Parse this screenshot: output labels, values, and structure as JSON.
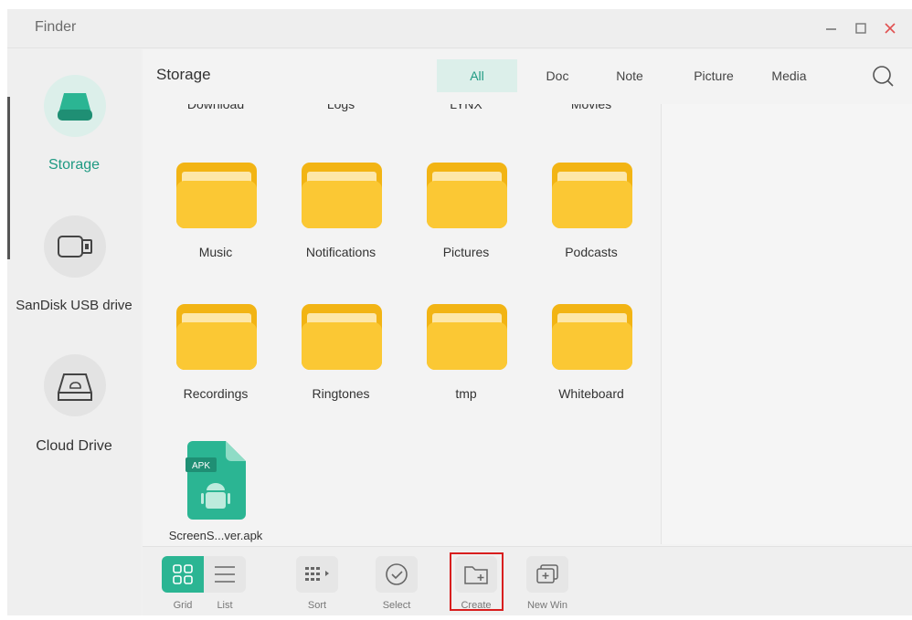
{
  "window": {
    "title": "Finder",
    "controls": {
      "minimize": "minimize",
      "maximize": "maximize",
      "close": "close"
    }
  },
  "sidebar": {
    "items": [
      {
        "label": "Storage",
        "icon": "drive-icon",
        "active": true
      },
      {
        "label": "SanDisk USB drive",
        "icon": "usb-icon",
        "active": false
      },
      {
        "label": "Cloud Drive",
        "icon": "cloud-drive-icon",
        "active": false
      }
    ]
  },
  "header": {
    "title": "Storage",
    "tabs": [
      {
        "label": "All",
        "active": true
      },
      {
        "label": "Doc",
        "active": false
      },
      {
        "label": "Note",
        "active": false
      },
      {
        "label": "Picture",
        "active": false
      },
      {
        "label": "Media",
        "active": false
      }
    ],
    "search_icon": "search-icon"
  },
  "files": {
    "partial_row": [
      "Download",
      "Logs",
      "LYNX",
      "Movies"
    ],
    "folders": [
      "Music",
      "Notifications",
      "Pictures",
      "Podcasts",
      "Recordings",
      "Ringtones",
      "tmp",
      "Whiteboard"
    ],
    "apk": {
      "name": "ScreenS...ver.apk",
      "badge": "APK"
    }
  },
  "toolbar": {
    "grid": "Grid",
    "list": "List",
    "sort": "Sort",
    "select": "Select",
    "create": "Create",
    "new_win": "New Win"
  },
  "colors": {
    "accent": "#2bb593",
    "accent_light": "#dcefea",
    "folder": "#f2b414",
    "folder_front": "#fbc834",
    "highlight": "#d81e1e"
  }
}
